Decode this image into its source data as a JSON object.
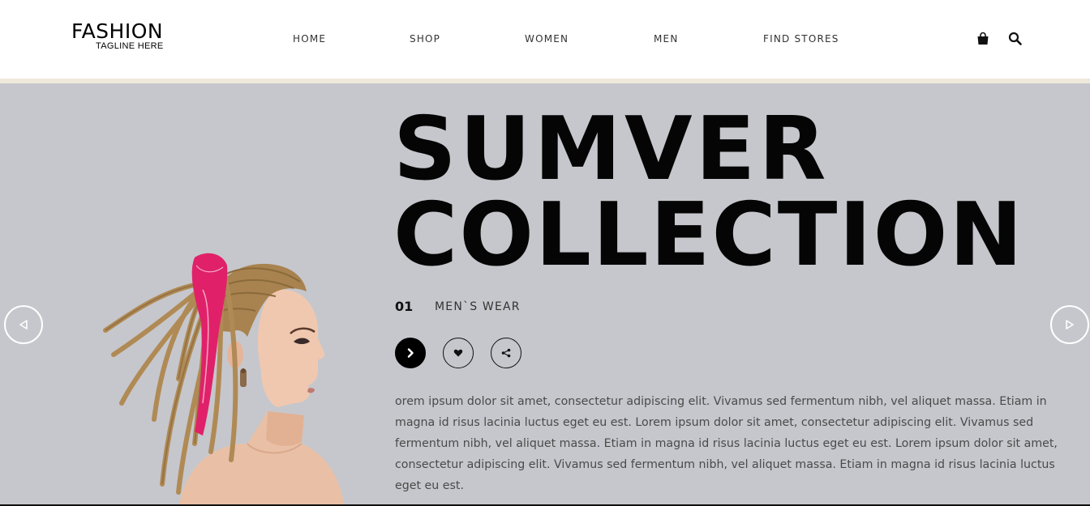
{
  "brand": {
    "name": "FASHION",
    "tagline": "TAGLINE HERE"
  },
  "nav": {
    "items": [
      {
        "label": "HOME"
      },
      {
        "label": "SHOP"
      },
      {
        "label": "WOMEN"
      },
      {
        "label": "MEN"
      },
      {
        "label": "FIND STORES"
      }
    ]
  },
  "header_icons": {
    "cart": "shopping-bag-icon",
    "search": "search-icon"
  },
  "hero": {
    "headline_line1": "SUMVER",
    "headline_line2": "COLLECTION",
    "slide_number": "01",
    "category": "MEN`S WEAR",
    "description": "orem ipsum dolor sit amet, consectetur adipiscing elit. Vivamus sed fermentum nibh, vel aliquet massa. Etiam in magna id risus lacinia luctus eget eu est. Lorem ipsum dolor sit amet, consectetur adipiscing elit. Vivamus sed fermentum nibh, vel aliquet massa. Etiam in magna id risus lacinia luctus eget eu est. Lorem ipsum dolor sit amet, consectetur adipiscing elit. Vivamus sed fermentum nibh, vel aliquet massa. Etiam in magna id risus lacinia luctus eget eu est.",
    "actions": [
      "chevron-right-icon",
      "heart-icon",
      "share-icon"
    ],
    "slider_controls": [
      "prev-arrow-icon",
      "next-arrow-icon"
    ]
  },
  "colors": {
    "hero_background": "#c6c7cc",
    "header_band": "#efe9dc",
    "text_dark": "#050505",
    "bandana": "#e0216a"
  }
}
